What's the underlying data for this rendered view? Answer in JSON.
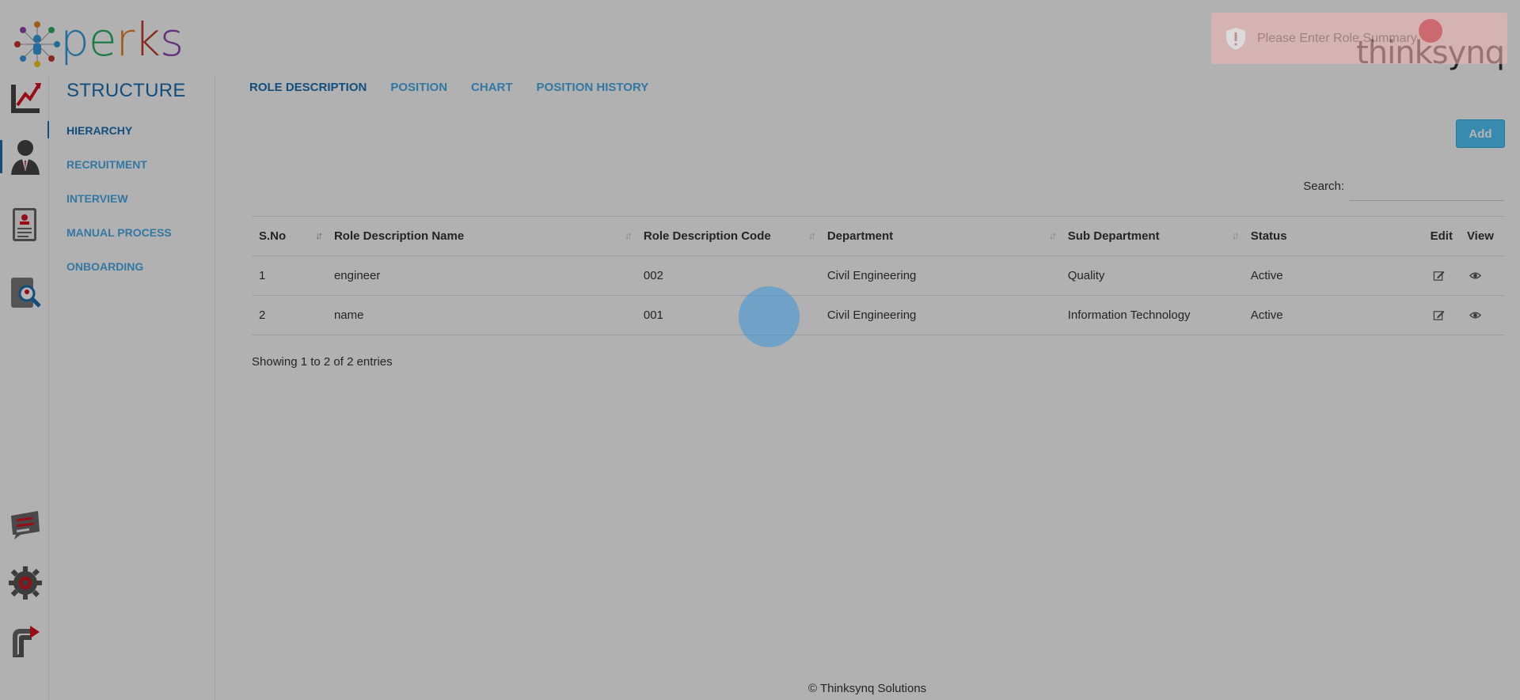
{
  "logo": {
    "letters": [
      "p",
      "e",
      "r",
      "k",
      "s"
    ]
  },
  "brand": {
    "name": "thinksynq"
  },
  "rail": {
    "items": [
      {
        "name": "dashboard-icon",
        "active": false
      },
      {
        "name": "employee-icon",
        "active": true
      },
      {
        "name": "document-icon",
        "active": false
      },
      {
        "name": "search-profile-icon",
        "active": false
      },
      {
        "name": "chat-icon",
        "active": false
      },
      {
        "name": "settings-gear-icon",
        "active": false
      },
      {
        "name": "logout-icon",
        "active": false
      }
    ]
  },
  "submenu": {
    "title": "STRUCTURE",
    "items": [
      {
        "label": "HIERARCHY",
        "active": true
      },
      {
        "label": "RECRUITMENT",
        "active": false
      },
      {
        "label": "INTERVIEW",
        "active": false
      },
      {
        "label": "MANUAL PROCESS",
        "active": false
      },
      {
        "label": "ONBOARDING",
        "active": false
      }
    ]
  },
  "tabs": [
    {
      "label": "ROLE DESCRIPTION",
      "active": true
    },
    {
      "label": "POSITION",
      "active": false
    },
    {
      "label": "CHART",
      "active": false
    },
    {
      "label": "POSITION HISTORY",
      "active": false
    }
  ],
  "toolbar": {
    "add_label": "Add"
  },
  "search": {
    "label": "Search:",
    "value": ""
  },
  "table": {
    "columns": [
      "S.No",
      "Role Description Name",
      "Role Description Code",
      "Department",
      "Sub Department",
      "Status",
      "Edit",
      "View"
    ],
    "rows": [
      {
        "sno": "1",
        "name": "engineer",
        "code": "002",
        "department": "Civil Engineering",
        "sub_department": "Quality",
        "status": "Active"
      },
      {
        "sno": "2",
        "name": "name",
        "code": "001",
        "department": "Civil Engineering",
        "sub_department": "Information Technology",
        "status": "Active"
      }
    ],
    "info": "Showing 1 to 2 of 2 entries"
  },
  "footer": {
    "text": "© Thinksynq Solutions"
  },
  "toast": {
    "message": "Please Enter Role Summary"
  },
  "colors": {
    "primary": "#1a6fb0",
    "link": "#48a9e6",
    "button": "#4fc3f7",
    "brand_dot": "#d8121f"
  }
}
